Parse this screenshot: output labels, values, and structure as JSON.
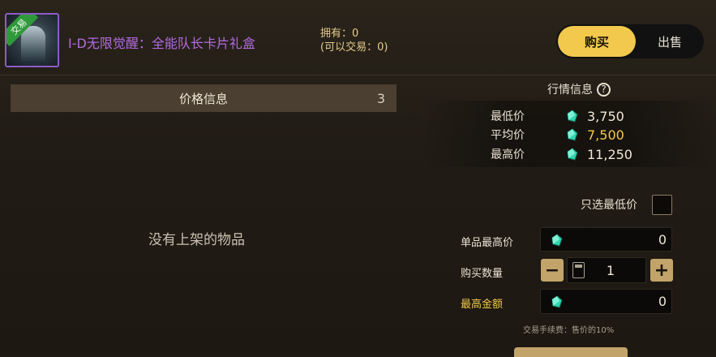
{
  "item": {
    "name": "I-D无限觉醒：全能队长卡片礼盒",
    "badge": "交易",
    "owned_line1": "拥有：0",
    "owned_line2": "(可以交易：0)"
  },
  "tabs": {
    "buy": "购买",
    "sell": "出售",
    "active": "buy"
  },
  "price_info": {
    "title": "价格信息",
    "count": "3",
    "empty_text": "没有上架的物品"
  },
  "market": {
    "title": "行情信息",
    "help": "?",
    "rows": [
      {
        "label": "最低价",
        "value": "3,750",
        "color": "#efe7d6"
      },
      {
        "label": "平均价",
        "value": "7,500",
        "color": "#f2c94c"
      },
      {
        "label": "最高价",
        "value": "11,250",
        "color": "#efe7d6"
      }
    ]
  },
  "form": {
    "only_lowest_label": "只选最低价",
    "only_lowest_checked": false,
    "unit_max_label": "单品最高价",
    "unit_max_value": "0",
    "quantity_label": "购买数量",
    "quantity_value": "1",
    "minus": "−",
    "plus": "+",
    "max_total_label": "最高金额",
    "max_total_value": "0",
    "fee_text": "交易手续费：售价的10%"
  },
  "colors": {
    "accent": "#f2c94c",
    "purple": "#b36be0",
    "gem": "#2fd6b0"
  }
}
